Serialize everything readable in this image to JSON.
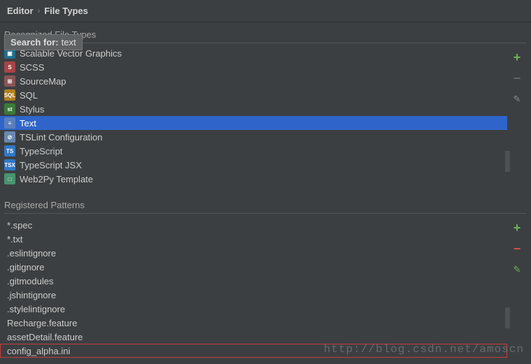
{
  "breadcrumb": {
    "page": "Editor",
    "sub": "File Types"
  },
  "search": {
    "label": "Search for:",
    "value": "text"
  },
  "sections": {
    "recognized": "Recognized File Types",
    "patterns": "Registered Patterns"
  },
  "fileTypes": [
    {
      "label": "Scalable Vector Graphics",
      "iconText": "▣",
      "iconClass": "ic-svg",
      "selected": false
    },
    {
      "label": "SCSS",
      "iconText": "S",
      "iconClass": "ic-scss",
      "selected": false
    },
    {
      "label": "SourceMap",
      "iconText": "⊞",
      "iconClass": "ic-map",
      "selected": false
    },
    {
      "label": "SQL",
      "iconText": "SQL",
      "iconClass": "ic-sql",
      "selected": false
    },
    {
      "label": "Stylus",
      "iconText": "st",
      "iconClass": "ic-styl",
      "selected": false
    },
    {
      "label": "Text",
      "iconText": "≡",
      "iconClass": "ic-text",
      "selected": true
    },
    {
      "label": "TSLint Configuration",
      "iconText": "⊘",
      "iconClass": "ic-tslint",
      "selected": false
    },
    {
      "label": "TypeScript",
      "iconText": "TS",
      "iconClass": "ic-ts",
      "selected": false
    },
    {
      "label": "TypeScript JSX",
      "iconText": "TSX",
      "iconClass": "ic-tsx",
      "selected": false
    },
    {
      "label": "Web2Py Template",
      "iconText": "□",
      "iconClass": "ic-web2py",
      "selected": false
    }
  ],
  "patterns": [
    {
      "label": "*.spec",
      "highlighted": false
    },
    {
      "label": "*.txt",
      "highlighted": false
    },
    {
      "label": ".eslintignore",
      "highlighted": false
    },
    {
      "label": ".gitignore",
      "highlighted": false
    },
    {
      "label": ".gitmodules",
      "highlighted": false
    },
    {
      "label": ".jshintignore",
      "highlighted": false
    },
    {
      "label": ".stylelintignore",
      "highlighted": false
    },
    {
      "label": "Recharge.feature",
      "highlighted": false
    },
    {
      "label": "assetDetail.feature",
      "highlighted": false
    },
    {
      "label": "config_alpha.ini",
      "highlighted": true
    }
  ],
  "watermark": "http://blog.csdn.net/amoscn"
}
